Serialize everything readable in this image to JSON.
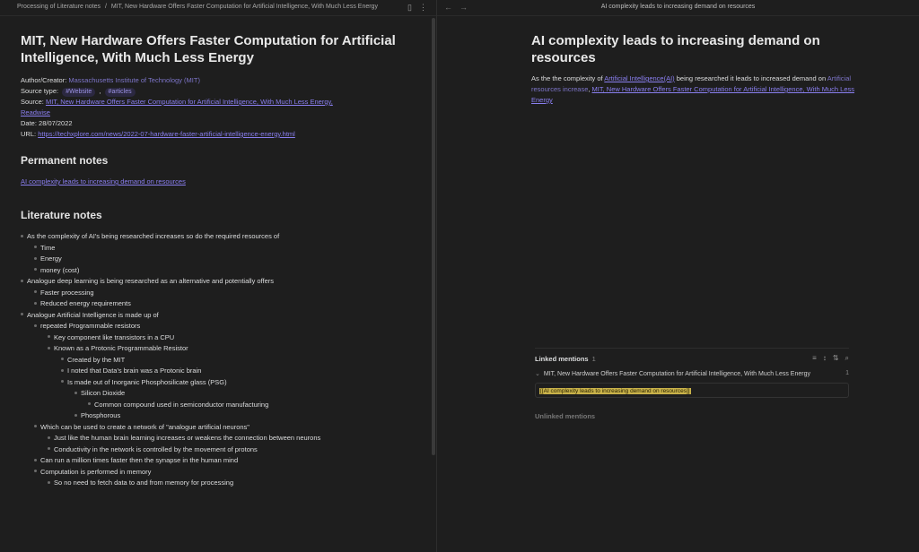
{
  "left": {
    "breadcrumb": "Processing of Literature notes",
    "breadcrumb_sep": "/",
    "breadcrumb_file": "MIT, New Hardware Offers Faster Computation for Artificial Intelligence, With Much Less Energy",
    "title": "MIT, New Hardware Offers Faster Computation for Artificial Intelligence, With Much Less Energy",
    "meta": {
      "author_label": "Author/Creator:",
      "author_value": "Massachusetts Institute of Technology (MIT)",
      "source_type_label": "Source type:",
      "tag1": "#Website",
      "tag_sep": ",",
      "tag2": "#articles",
      "source_label": "Source:",
      "source_value": "MIT, New Hardware Offers Faster Computation for Artificial Intelligence, With Much Less Energy, Readwise",
      "date_label": "Date:",
      "date_value": "28/07/2022",
      "url_label": "URL:",
      "url_value": "https://techxplore.com/news/2022-07-hardware-faster-artificial-intelligence-energy.html"
    },
    "permanent_heading": "Permanent notes",
    "permanent_link": "AI complexity leads to increasing demand on resources",
    "literature_heading": "Literature notes",
    "lit_items": [
      {
        "level": 0,
        "text": "As the complexity of AI's being researched increases so do the required resources of"
      },
      {
        "level": 1,
        "text": "Time"
      },
      {
        "level": 1,
        "text": "Energy"
      },
      {
        "level": 1,
        "text": "money (cost)"
      },
      {
        "level": 0,
        "text": "Analogue deep learning is being researched as an alternative and potentially offers"
      },
      {
        "level": 1,
        "text": "Faster processing"
      },
      {
        "level": 1,
        "text": "Reduced energy requirements"
      },
      {
        "level": 0,
        "text": "Analogue Artificial Intelligence is made up of"
      },
      {
        "level": 1,
        "text": "repeated Programmable resistors"
      },
      {
        "level": 2,
        "text": "Key component like transistors in a CPU"
      },
      {
        "level": 2,
        "text": "Known as a Protonic Programmable Resistor"
      },
      {
        "level": 3,
        "text": "Created by the MIT"
      },
      {
        "level": 3,
        "text": "I noted that Data's brain was a Protonic brain"
      },
      {
        "level": 3,
        "text": "Is made out of Inorganic Phosphosilicate glass (PSG)"
      },
      {
        "level": 4,
        "text": "Silicon Dioxide"
      },
      {
        "level": 5,
        "text": "Common compound used in semiconductor manufacturing"
      },
      {
        "level": 4,
        "text": "Phosphorous"
      },
      {
        "level": 1,
        "text": "Which can be used to create a network of \"analogue artificial neurons\""
      },
      {
        "level": 2,
        "text": "Just like the human brain learning increases or weakens the connection between neurons"
      },
      {
        "level": 2,
        "text": "Conductivity in the network is controlled by the movement of protons"
      },
      {
        "level": 1,
        "text": "Can run a million times faster then the synapse in the human mind"
      },
      {
        "level": 1,
        "text": "Computation is performed in memory"
      },
      {
        "level": 2,
        "text": "So no need to fetch data to and from memory for processing"
      }
    ]
  },
  "right": {
    "tab_title": "AI complexity leads to increasing demand on resources",
    "title": "AI complexity leads to increasing demand on resources",
    "body_pre": "As the the complexity of ",
    "body_link1": "Artificial Intelligence(AI)",
    "body_mid": " being researched it leads to increased demand on ",
    "body_link2": "Artificial resources increase",
    "body_sep": ", ",
    "body_link3": "MIT, New Hardware Offers Faster Computation for Artificial Intelligence, With Much Less Energy",
    "linked_label": "Linked mentions",
    "linked_count": "1",
    "mention_file": "MIT, New Hardware Offers Faster Computation for Artificial Intelligence, With Much Less Energy",
    "mention_count": "1",
    "mention_text": "[[AI complexity leads to increasing demand on resources]]",
    "unlinked_label": "Unlinked mentions"
  }
}
